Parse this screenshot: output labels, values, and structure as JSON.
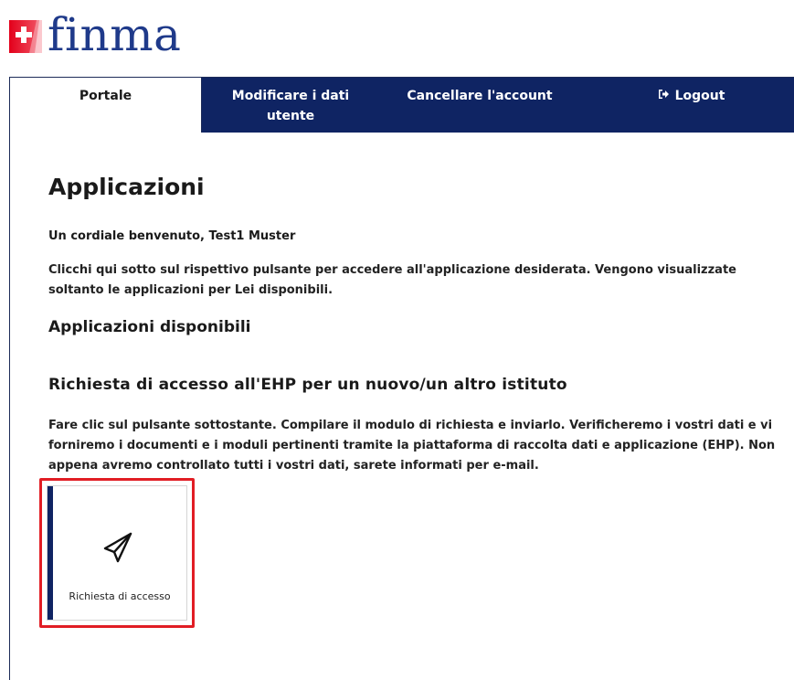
{
  "logo": {
    "text": "finma"
  },
  "tabs": [
    {
      "label": "Portale"
    },
    {
      "label_line1": "Modificare i dati",
      "label_line2": "utente"
    },
    {
      "label": "Cancellare l'account"
    },
    {
      "label": "Logout",
      "icon": "logout-icon"
    }
  ],
  "main": {
    "title": "Applicazioni",
    "welcome": "Un cordiale benvenuto, Test1 Muster",
    "intro": "Clicchi qui sotto sul rispettivo pulsante per accedere all'applicazione desiderata. Vengono visualizzate soltanto le applicazioni per Lei disponibili.",
    "available_heading": "Applicazioni disponibili",
    "request_heading": "Richiesta di accesso all'EHP per un nuovo/un altro istituto",
    "request_description": "Fare clic sul pulsante sottostante. Compilare il modulo di richiesta e inviarlo. Verificheremo i vostri dati e vi forniremo i documenti e i moduli pertinenti tramite la piattaforma di raccolta dati e applicazione (EHP). Non appena avremo controllato tutti i vostri dati, sarete informati per e-mail."
  },
  "card": {
    "label": "Richiesta di accesso",
    "icon": "paper-plane-icon"
  },
  "colors": {
    "navy": "#0f2463",
    "highlight": "#e11d24",
    "logo_red": "#e3001b"
  }
}
